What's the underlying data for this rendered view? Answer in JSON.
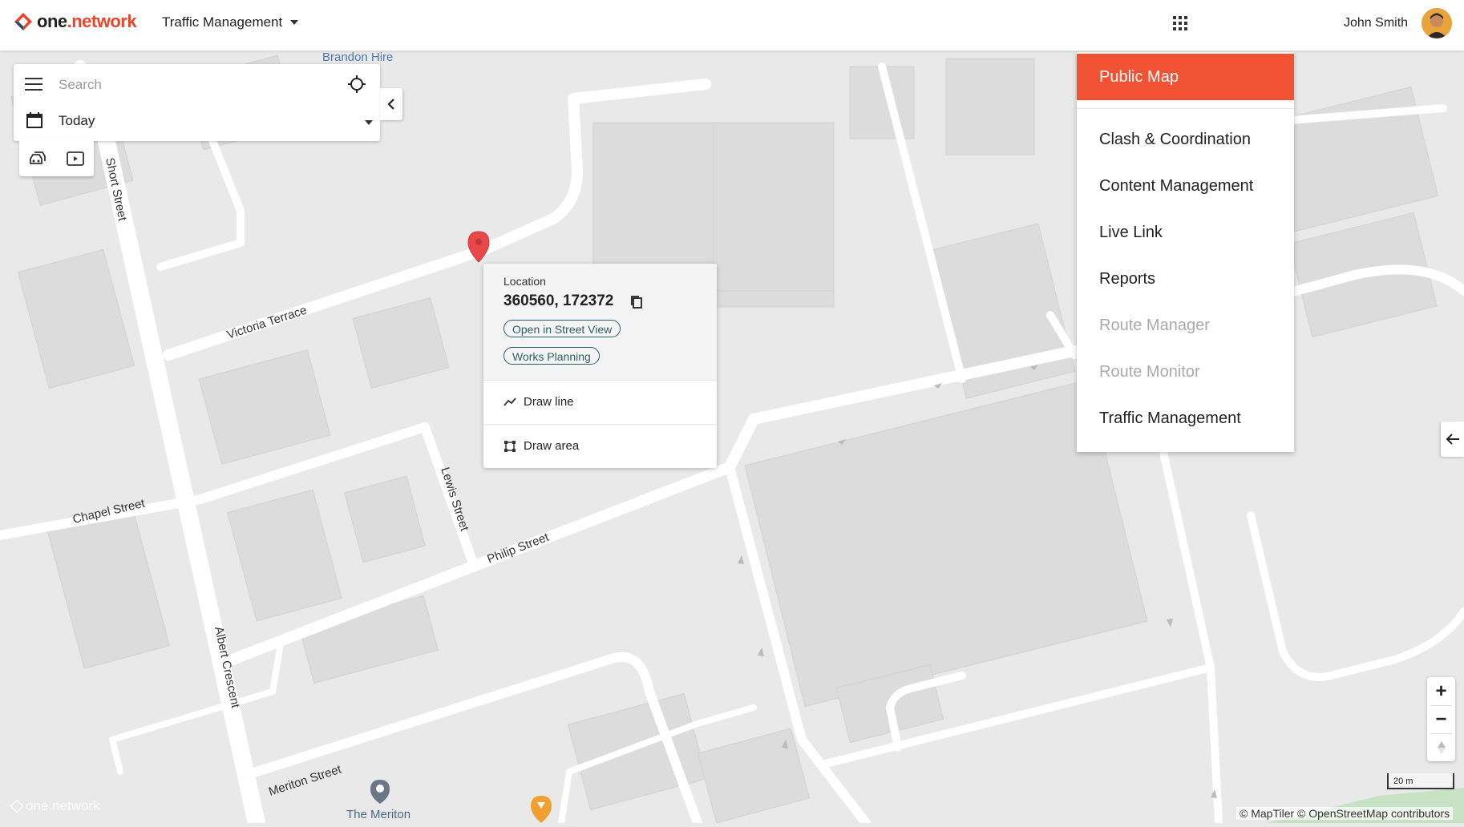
{
  "header": {
    "brand_prefix": "one",
    "brand_suffix": ".network",
    "app_selector": "Traffic Management",
    "user_name": "John Smith"
  },
  "search": {
    "placeholder": "Search",
    "date_value": "Today"
  },
  "popup": {
    "location_label": "Location",
    "location_value": "360560, 172372",
    "street_view_button": "Open in Street View",
    "works_planning_button": "Works Planning",
    "draw_line_label": "Draw line",
    "draw_area_label": "Draw area"
  },
  "app_menu": {
    "items": [
      {
        "label": "Public Map",
        "state": "active"
      },
      {
        "label": "Clash & Coordination",
        "state": "enabled"
      },
      {
        "label": "Content Management",
        "state": "enabled"
      },
      {
        "label": "Live Link",
        "state": "enabled"
      },
      {
        "label": "Reports",
        "state": "enabled"
      },
      {
        "label": "Route Manager",
        "state": "disabled"
      },
      {
        "label": "Route Monitor",
        "state": "disabled"
      },
      {
        "label": "Traffic Management",
        "state": "enabled"
      }
    ]
  },
  "map": {
    "streets": [
      "Victoria Terrace",
      "Short Street",
      "Chapel Street",
      "Lewis Street",
      "Philip Street",
      "Albert Crescent",
      "Meriton Street"
    ],
    "pois": [
      "Brandon Hire",
      "The Meriton"
    ],
    "scale_label": "20 m",
    "attribution": "© MapTiler © OpenStreetMap contributors",
    "watermark": "one.network"
  },
  "colors": {
    "brand_accent": "#e8452c",
    "menu_active": "#f05233",
    "pill_border": "#2e5f64",
    "map_bg": "#e9e9ea",
    "road": "#ffffff",
    "building": "#dcdcdd",
    "pin": "#e8484a"
  },
  "icons": [
    "menu-icon",
    "locate-icon",
    "calendar-icon",
    "collapse-left-icon",
    "traffic-icon",
    "media-icon",
    "copy-icon",
    "draw-line-icon",
    "draw-area-icon",
    "apps-grid-icon",
    "arrow-left-icon",
    "zoom-in-icon",
    "zoom-out-icon",
    "compass-icon",
    "map-pin-icon"
  ]
}
